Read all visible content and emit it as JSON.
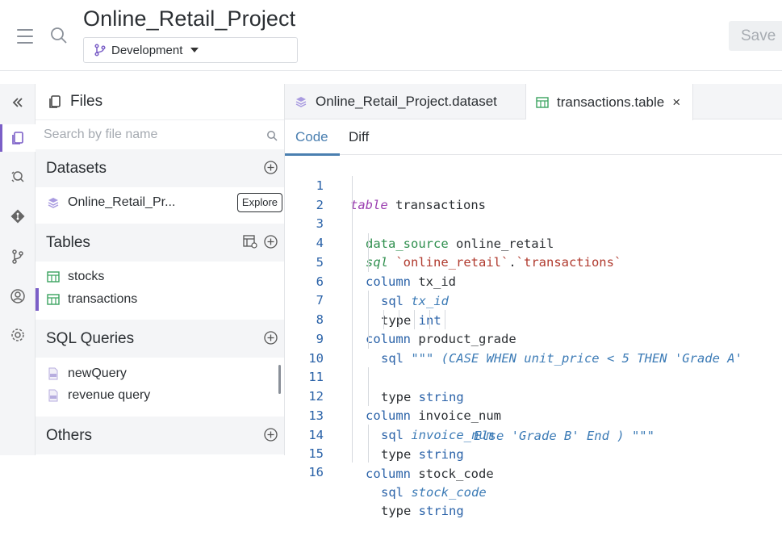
{
  "app": {
    "title": "Online_Retail_Project",
    "branch": "Development",
    "save_label": "Save"
  },
  "files_panel": {
    "title": "Files",
    "search_placeholder": "Search by file name",
    "sections": {
      "datasets": {
        "label": "Datasets",
        "items": [
          {
            "label": "Online_Retail_Pr...",
            "action": "Explore"
          }
        ]
      },
      "tables": {
        "label": "Tables",
        "items": [
          {
            "label": "stocks"
          },
          {
            "label": "transactions"
          }
        ]
      },
      "sql_queries": {
        "label": "SQL Queries",
        "items": [
          {
            "label": "newQuery"
          },
          {
            "label": "revenue query"
          }
        ]
      },
      "others": {
        "label": "Others"
      }
    }
  },
  "editor": {
    "tabs": [
      {
        "label": "Online_Retail_Project.dataset",
        "active": false
      },
      {
        "label": "transactions.table",
        "active": true,
        "close": "×"
      }
    ],
    "subtabs": [
      "Code",
      "Diff"
    ],
    "lines": [
      {
        "n": "1"
      },
      {
        "n": "2"
      },
      {
        "n": "3"
      },
      {
        "n": "4"
      },
      {
        "n": "5"
      },
      {
        "n": "6"
      },
      {
        "n": "7"
      },
      {
        "n": "8"
      },
      {
        "n": "9"
      },
      {
        "n": "10"
      },
      {
        "n": "11"
      },
      {
        "n": "12"
      },
      {
        "n": "13"
      },
      {
        "n": "14"
      },
      {
        "n": "15"
      },
      {
        "n": "16"
      }
    ],
    "code": {
      "l1a": "table",
      "l1b": " transactions",
      "l2a": "data_source",
      "l2b": " online_retail",
      "l3a": "sql",
      "l3b": " `online_retail`",
      "l3c": ".",
      "l3d": "`transactions`",
      "l4a": "column",
      "l4b": " tx_id",
      "l5a": "sql",
      "l5b": " tx_id",
      "l6a": "type",
      "l6b": " int",
      "l7a": "column",
      "l7b": " product_grade",
      "l8a": "sql",
      "l8b": " \"\"\" (CASE WHEN unit_price < 5 THEN 'Grade A'",
      "l9a": "Else 'Grade B' End ) \"\"\"",
      "l10a": "type",
      "l10b": " string",
      "l11a": "column",
      "l11b": " invoice_num",
      "l12a": "sql",
      "l12b": " invoice_num",
      "l13a": "type",
      "l13b": " string",
      "l14a": "column",
      "l14b": " stock_code",
      "l15a": "sql",
      "l15b": " stock_code",
      "l16a": "type",
      "l16b": " string"
    }
  },
  "colors": {
    "accent": "#7b5fc7",
    "link": "#4a7fb0",
    "keyword": "#9b3fb0",
    "field": "#2f8f4e",
    "string": "#b03a2e"
  }
}
